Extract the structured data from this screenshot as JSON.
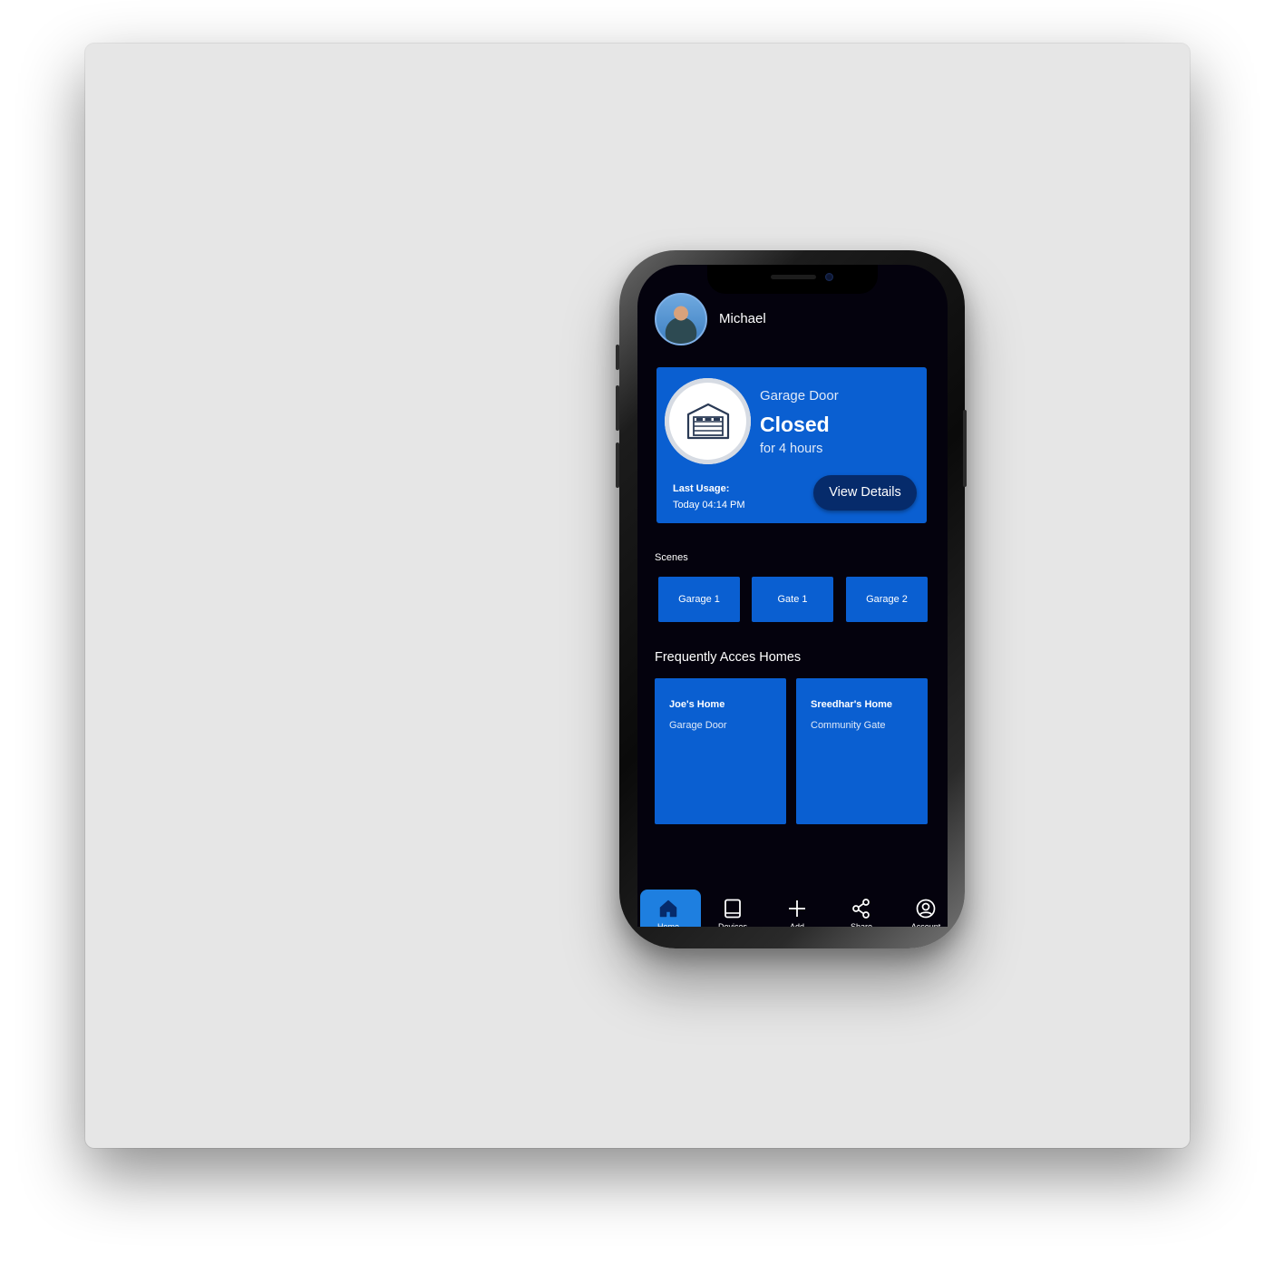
{
  "user": {
    "name": "Michael"
  },
  "device_card": {
    "name": "Garage Door",
    "state": "Closed",
    "duration": "for 4 hours",
    "last_usage_label": "Last Usage:",
    "last_usage_value": "Today 04:14 PM",
    "view_details_label": "View Details"
  },
  "scenes": {
    "title": "Scenes",
    "items": [
      "Garage 1",
      "Gate 1",
      "Garage 2"
    ]
  },
  "frequent_homes": {
    "title": "Frequently Acces Homes",
    "items": [
      {
        "name": "Joe's Home",
        "device": "Garage Door"
      },
      {
        "name": "Sreedhar's Home",
        "device": "Community Gate"
      }
    ]
  },
  "bottom_nav": {
    "items": [
      {
        "label": "Home",
        "icon": "home-icon",
        "active": true
      },
      {
        "label": "Devices",
        "icon": "tablet-icon",
        "active": false
      },
      {
        "label": "Add",
        "icon": "plus-icon",
        "active": false
      },
      {
        "label": "Share",
        "icon": "share-icon",
        "active": false
      },
      {
        "label": "Account",
        "icon": "account-icon",
        "active": false
      }
    ]
  },
  "colors": {
    "screen_bg": "#04020d",
    "card_blue": "#0a5fd1",
    "button_dark_blue": "#062b6b",
    "nav_active": "#1e7fe0",
    "window_bg": "#e6e6e6"
  }
}
